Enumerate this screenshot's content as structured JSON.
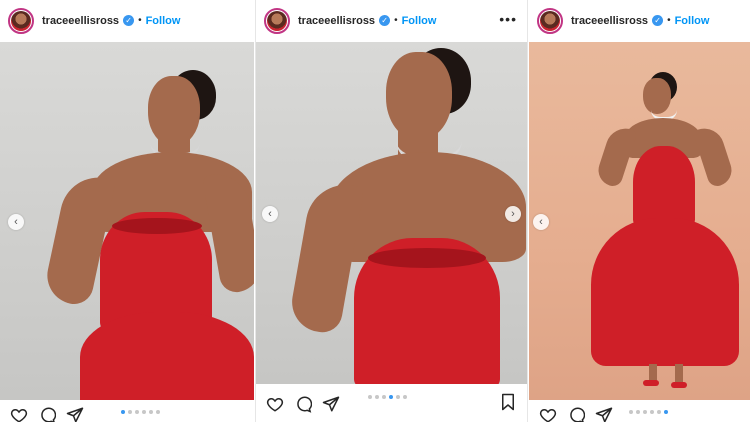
{
  "posts": [
    {
      "username": "traceeellisross",
      "follow_label": "Follow",
      "separator": "•",
      "verified_icon": "verified-badge-icon",
      "carousel": {
        "count": 6,
        "active": 0
      },
      "actions": [
        "heart-icon",
        "comment-icon",
        "share-icon"
      ]
    },
    {
      "username": "traceeellisross",
      "follow_label": "Follow",
      "separator": "•",
      "more_label": "•••",
      "verified_icon": "verified-badge-icon",
      "carousel": {
        "count": 6,
        "active": 3
      },
      "actions": [
        "heart-icon",
        "comment-icon",
        "share-icon",
        "bookmark-icon"
      ]
    },
    {
      "username": "traceeellisross",
      "follow_label": "Follow",
      "separator": "•",
      "verified_icon": "verified-badge-icon",
      "carousel": {
        "count": 6,
        "active": 5
      },
      "actions": [
        "heart-icon",
        "comment-icon",
        "share-icon"
      ]
    }
  ],
  "nav": {
    "prev_glyph": "‹",
    "next_glyph": "›"
  },
  "colors": {
    "follow": "#0095f6",
    "verified": "#3897f0",
    "dress": "#cf1f28",
    "active_dot": "#3897f0"
  }
}
